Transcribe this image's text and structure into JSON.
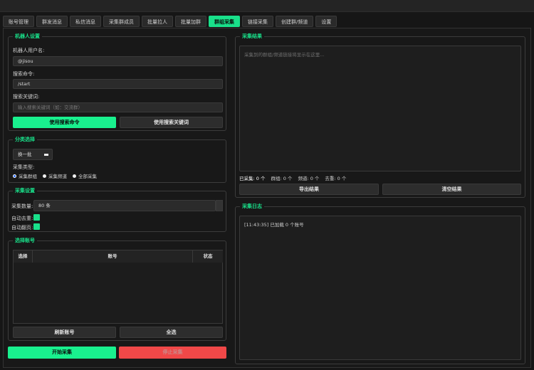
{
  "tabs": [
    {
      "label": "账号管理"
    },
    {
      "label": "群发消息"
    },
    {
      "label": "私信消息"
    },
    {
      "label": "采集群成员"
    },
    {
      "label": "批量拉人"
    },
    {
      "label": "批量加群"
    },
    {
      "label": "群组采集"
    },
    {
      "label": "链接采集"
    },
    {
      "label": "创建群/频道"
    },
    {
      "label": "设置"
    }
  ],
  "bot": {
    "title": "机器人设置",
    "username_label": "机器人用户名:",
    "username_value": "@jisou",
    "command_label": "搜索命令:",
    "command_value": "/start",
    "keyword_label": "搜索关键词:",
    "keyword_placeholder": "输入搜索关键词（如：交流群）",
    "use_command_btn": "使用搜索命令",
    "use_keyword_btn": "使用搜索关键词"
  },
  "category": {
    "title": "分类选择",
    "select_value": "换一批",
    "type_label": "采集类型:",
    "options": [
      "采集群组",
      "采集频道",
      "全部采集"
    ]
  },
  "collect": {
    "title": "采集设置",
    "count_label": "采集数量:",
    "count_value": "80 条",
    "dedup_label": "自动去重:",
    "pageturn_label": "自动翻页:"
  },
  "accounts": {
    "title": "选择账号",
    "col_select": "选择",
    "col_account": "账号",
    "col_status": "状态",
    "refresh_btn": "刷新账号",
    "select_all_btn": "全选"
  },
  "actions": {
    "start": "开始采集",
    "stop": "停止采集"
  },
  "results": {
    "title": "采集结果",
    "placeholder": "采集到的群组/频道链接将显示在这里...",
    "stats_collected": "已采集: 0 个",
    "stats_groups": "群组: 0 个",
    "stats_channels": "频道: 0 个",
    "stats_dupes": "去重: 0 个",
    "export_btn": "导出结果",
    "clear_btn": "清空结果"
  },
  "log": {
    "title": "采集日志",
    "entry": "[11:43:35] 已加载 0 个账号"
  },
  "colors": {
    "accent": "#19e08a",
    "danger": "#f04848"
  }
}
